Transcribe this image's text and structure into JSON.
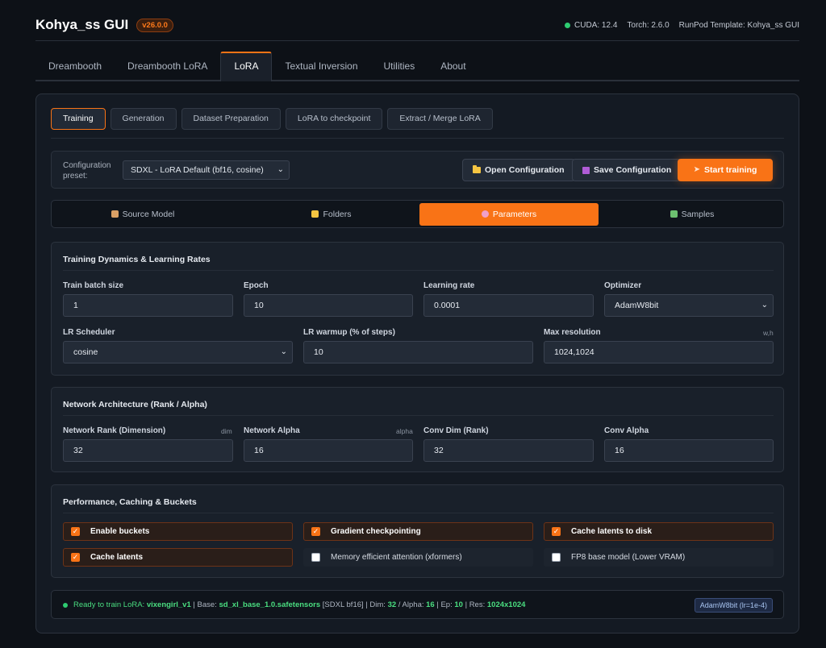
{
  "header": {
    "title": "Kohya_ss GUI",
    "version": "v26.0.0",
    "cuda": "CUDA: 12.4",
    "torch": "Torch: 2.6.0",
    "template": "RunPod Template: Kohya_ss GUI"
  },
  "main_tabs": [
    "Dreambooth",
    "Dreambooth LoRA",
    "LoRA",
    "Textual Inversion",
    "Utilities",
    "About"
  ],
  "main_tab_active": "LoRA",
  "sub_tabs": [
    "Training",
    "Generation",
    "Dataset Preparation",
    "LoRA to checkpoint",
    "Extract / Merge LoRA"
  ],
  "sub_tab_active": "Training",
  "config": {
    "label": "Configuration preset:",
    "preset_value": "SDXL - LoRA Default (bf16, cosine)",
    "open_label": "Open Configuration",
    "save_label": "Save Configuration",
    "start_label": "Start training"
  },
  "section_tabs": [
    "Source Model",
    "Folders",
    "Parameters",
    "Samples"
  ],
  "section_tab_active": "Parameters",
  "training": {
    "title": "Training Dynamics & Learning Rates",
    "batch_label": "Train batch size",
    "batch_value": "1",
    "epoch_label": "Epoch",
    "epoch_value": "10",
    "lr_label": "Learning rate",
    "lr_value": "0.0001",
    "optimizer_label": "Optimizer",
    "optimizer_value": "AdamW8bit",
    "scheduler_label": "LR Scheduler",
    "scheduler_value": "cosine",
    "warmup_label": "LR warmup (% of steps)",
    "warmup_value": "10",
    "resolution_label": "Max resolution",
    "resolution_hint": "w,h",
    "resolution_value": "1024,1024"
  },
  "network": {
    "title": "Network Architecture (Rank / Alpha)",
    "rank_label": "Network Rank (Dimension)",
    "rank_hint": "dim",
    "rank_value": "32",
    "alpha_label": "Network Alpha",
    "alpha_hint": "alpha",
    "alpha_value": "16",
    "convdim_label": "Conv Dim (Rank)",
    "convdim_value": "32",
    "convalpha_label": "Conv Alpha",
    "convalpha_value": "16"
  },
  "performance": {
    "title": "Performance, Caching & Buckets",
    "options": [
      {
        "label": "Enable buckets",
        "checked": true
      },
      {
        "label": "Gradient checkpointing",
        "checked": true
      },
      {
        "label": "Cache latents to disk",
        "checked": true
      },
      {
        "label": "Cache latents",
        "checked": true
      },
      {
        "label": "Memory efficient attention (xformers)",
        "checked": false
      },
      {
        "label": "FP8 base model (Lower VRAM)",
        "checked": false
      }
    ]
  },
  "status": {
    "ready_prefix": "Ready to train LoRA:",
    "lora_name": "vixengirl_v1",
    "base_prefix": "| Base:",
    "base_model": "sd_xl_base_1.0.safetensors",
    "base_tag": "[SDXL bf16]",
    "dim_prefix": "| Dim:",
    "dim": "32",
    "alpha_prefix": "/ Alpha:",
    "alpha": "16",
    "ep_prefix": "| Ep:",
    "ep": "10",
    "res_prefix": "| Res:",
    "res": "1024x1024",
    "badge": "AdamW8bit (lr=1e-4)"
  },
  "colors": {
    "accent": "#f97316",
    "ready_green": "#4ade80",
    "background": "#0d1117"
  }
}
